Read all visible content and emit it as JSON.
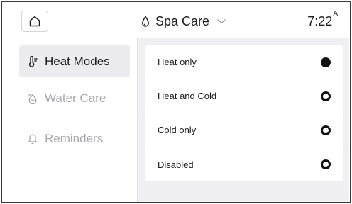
{
  "header": {
    "app_title": "Spa Care",
    "time": "7:22",
    "time_suffix": "A"
  },
  "sidebar": {
    "items": [
      {
        "label": "Heat Modes",
        "icon": "thermometer-icon",
        "active": true
      },
      {
        "label": "Water Care",
        "icon": "water-drops-icon",
        "active": false
      },
      {
        "label": "Reminders",
        "icon": "bell-icon",
        "active": false
      }
    ]
  },
  "heat_modes": {
    "options": [
      {
        "label": "Heat only",
        "selected": true
      },
      {
        "label": "Heat and Cold",
        "selected": false
      },
      {
        "label": "Cold only",
        "selected": false
      },
      {
        "label": "Disabled",
        "selected": false
      }
    ]
  },
  "colors": {
    "accent": "#111111",
    "active_bg": "#ececee",
    "content_bg": "#f0f0f2",
    "muted_text": "#a9a9ad"
  }
}
